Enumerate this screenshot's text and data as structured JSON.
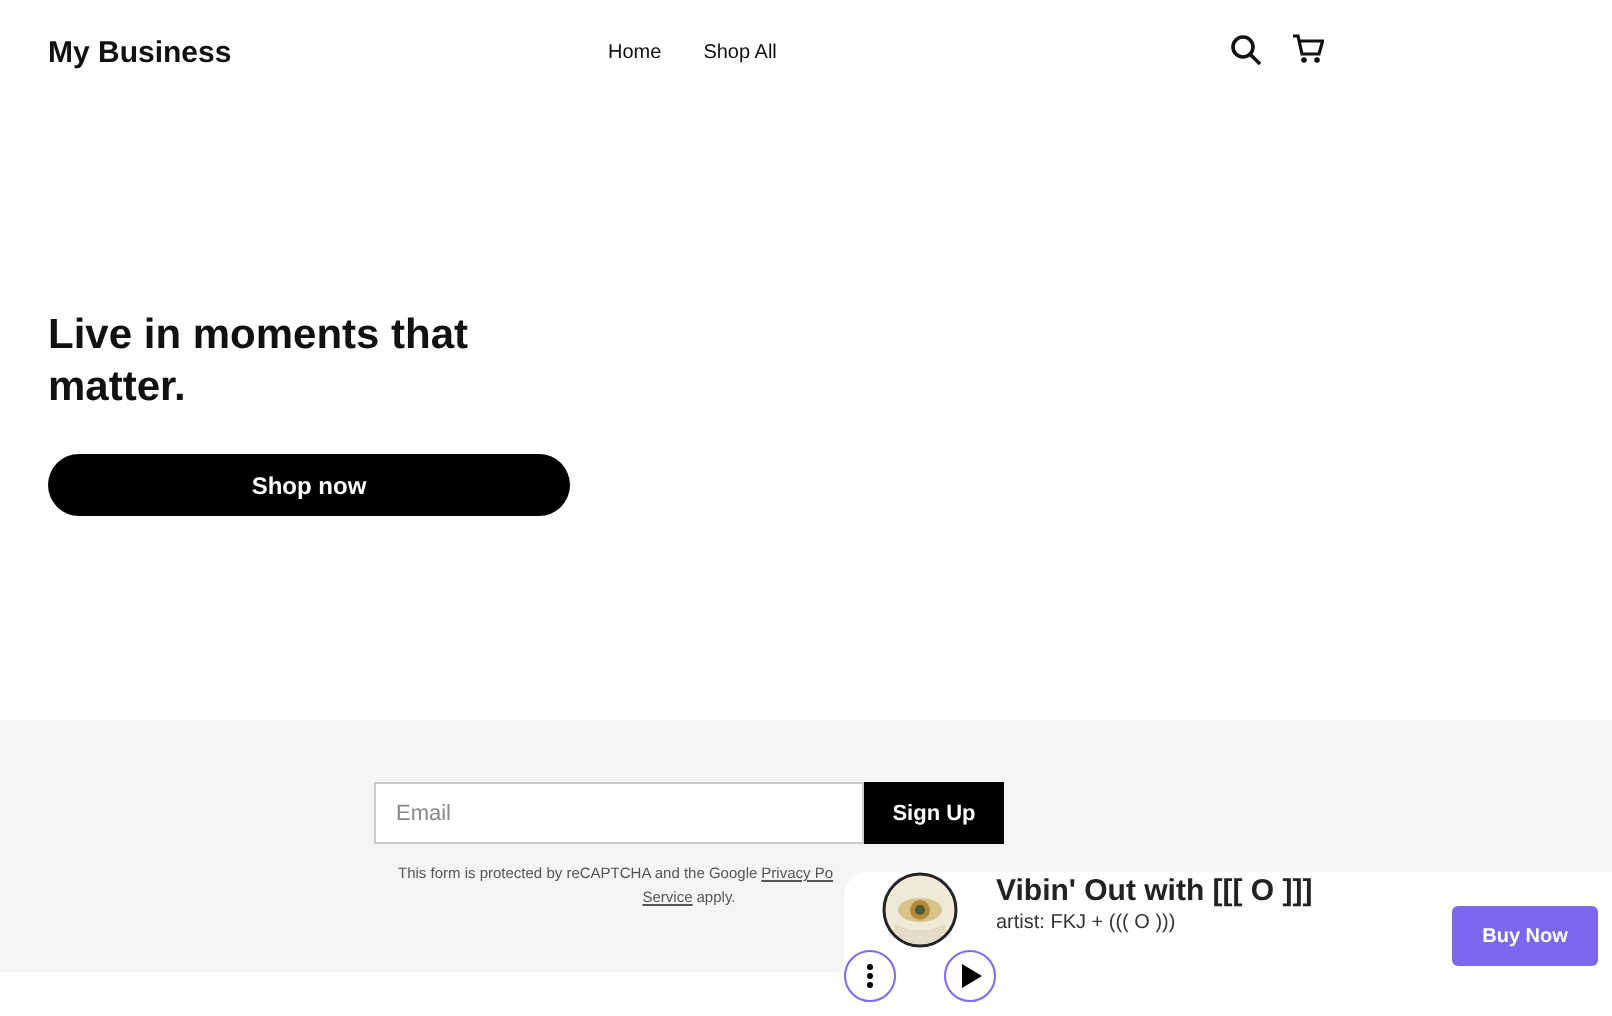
{
  "header": {
    "logo": "My Business",
    "nav": [
      {
        "label": "Home"
      },
      {
        "label": "Shop All"
      }
    ]
  },
  "hero": {
    "heading": "Live in moments that matter.",
    "button": "Shop now"
  },
  "signup": {
    "placeholder": "Email",
    "button": "Sign Up",
    "notice_start": "This form is protected by reCAPTCHA and the Google",
    "notice_link": "Privacy Po",
    "notice_link2": "Service",
    "notice_end": "apply."
  },
  "player": {
    "title": "Vibin' Out with [[[ O ]]]",
    "artist": "artist: FKJ + ((( O )))",
    "button": "Buy Now"
  }
}
